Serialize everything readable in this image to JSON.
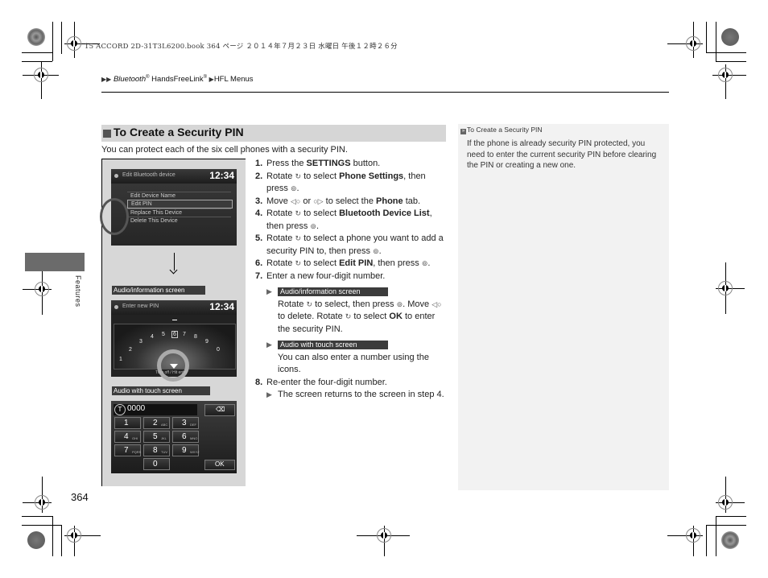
{
  "print_header": "15 ACCORD 2D-31T3L6200.book  364 ページ  ２０１４年７月２３日  水曜日  午後１２時２６分",
  "breadcrumb": {
    "items": [
      "Bluetooth® HandsFreeLink®",
      "HFL Menus"
    ],
    "item0_italic": "Bluetooth",
    "item0_rest": " HandsFreeLink",
    "item1": "HFL Menus"
  },
  "section": {
    "title": "To Create a Security PIN",
    "intro": "You can protect each of the six cell phones with a security PIN."
  },
  "sidebar_note": {
    "title": "To Create a Security PIN",
    "body": "If the phone is already security PIN protected, you need to enter the current security PIN before clearing the PIN or creating a new one."
  },
  "figure": {
    "screen1": {
      "title": "Edit Bluetooth device",
      "clock": "12:34",
      "menu": [
        "Edit Device Name",
        "Edit PIN",
        "Replace This Device",
        "Delete This Device"
      ],
      "selected_index": 1
    },
    "label_audio": "Audio/information screen",
    "screen2": {
      "title": "Enter new PIN",
      "clock": "12:34",
      "dial": [
        "1",
        "2",
        "3",
        "4",
        "5",
        "6",
        "7",
        "8",
        "9",
        "0"
      ],
      "selected_digit": "6",
      "footer": "Turn off / Hit entry"
    },
    "label_touch": "Audio with touch screen",
    "screen3": {
      "entry": "0000",
      "keys": [
        {
          "n": "1",
          "s": ""
        },
        {
          "n": "2",
          "s": "ABC"
        },
        {
          "n": "3",
          "s": "DEF"
        },
        {
          "n": "4",
          "s": "GHI"
        },
        {
          "n": "5",
          "s": "JKL"
        },
        {
          "n": "6",
          "s": "MNO"
        },
        {
          "n": "7",
          "s": "PQRS"
        },
        {
          "n": "8",
          "s": "TUV"
        },
        {
          "n": "9",
          "s": "WXYZ"
        },
        {
          "n": "0",
          "s": ""
        }
      ],
      "ok_label": "OK",
      "delete_label": "⌫"
    }
  },
  "steps": [
    {
      "num": "1.",
      "pre": "Press the ",
      "bold": "SETTINGS",
      "post": " button."
    },
    {
      "num": "2.",
      "pre": "Rotate ",
      "mid": " to select ",
      "bold": "Phone Settings",
      "post": ", then press ",
      "end": "."
    },
    {
      "num": "3.",
      "pre": "Move ",
      "or": " or ",
      "mid": " to select the ",
      "bold": "Phone",
      "post": " tab."
    },
    {
      "num": "4.",
      "pre": "Rotate ",
      "mid": " to select ",
      "bold": "Bluetooth Device List",
      "post": ", then press ",
      "end": "."
    },
    {
      "num": "5.",
      "pre": "Rotate ",
      "mid": " to select a phone you want to add a security PIN to, then press ",
      "end": "."
    },
    {
      "num": "6.",
      "pre": "Rotate ",
      "mid": " to select ",
      "bold": "Edit PIN",
      "post": ", then press ",
      "end": "."
    },
    {
      "num": "7.",
      "text": "Enter a new four-digit number."
    },
    {
      "num": "8.",
      "text": "Re-enter the four-digit number."
    }
  ],
  "notes": {
    "audio_label": "Audio/information screen",
    "audio_l1a": "Rotate ",
    "audio_l1b": " to select, then press ",
    "audio_l2a": "Move ",
    "audio_l2b": " to delete. Rotate ",
    "audio_l2c": " to select",
    "audio_ok": "OK",
    "audio_l3": " to enter the security PIN.",
    "touch_label": "Audio with touch screen",
    "touch_text": "You can also enter a number using the icons.",
    "step8_note": "The screen returns to the screen in step 4."
  },
  "icons": {
    "knob_rotate": "↻",
    "knob_press": "⊚",
    "knob_left": "◁○",
    "knob_right": "○▷",
    "arrow": "▶"
  },
  "page_number": "364",
  "side_tab": "Features"
}
